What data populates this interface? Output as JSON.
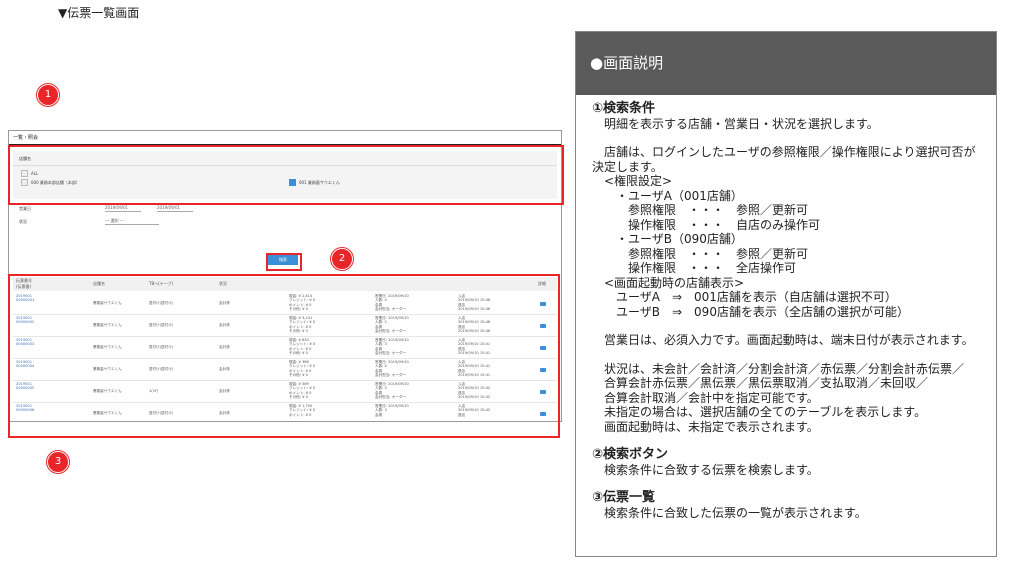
{
  "page_title": "▼伝票一覧画面",
  "mock": {
    "header": "一覧・照会",
    "panel_label": "店舗名",
    "checks": [
      {
        "label": "ALL",
        "checked": false
      },
      {
        "label": "000 業務本部店舗（本部）",
        "checked": false
      },
      {
        "label": "001 業務量サウエくん",
        "checked": true
      }
    ],
    "form": {
      "date_label": "営業日",
      "date_from": "2019/09/01",
      "date_to": "2019/09/01",
      "status_label": "状況",
      "status_value": "--- 選択 ---"
    },
    "search_button": "検索",
    "columns": [
      "伝票番号\n(伝票番)",
      "店舗名",
      "TBへ(テーブ)",
      "状況",
      "",
      "",
      "",
      "詳細"
    ],
    "rows": [
      {
        "id": "2019001\n00000001",
        "store": "業務量サウエくん",
        "table": "居付け(居付け)",
        "status": "会計済",
        "amounts": "現金: ¥ 2,414\nクレジット: ¥ 0\nポイント: ¥ 0\nその他: ¥ 0",
        "info": "営業日: 2019/09/10\n人数: 4\n会員\n会計担当: オーダー",
        "times": "入店\n2019/09/10 15:46\n退店\n2019/09/10 15:46"
      },
      {
        "id": "2019001\n00000002",
        "store": "業務量サウエくん",
        "table": "居付け(居付け)",
        "status": "会計済",
        "amounts": "現金: ¥ 3,141\nクレジット: ¥ 0\nポイント: ¥ 0\nその他: ¥ 0",
        "info": "営業日: 2019/09/10\n人数: 2\n会員\n会計担当: オーダー",
        "times": "入店\n2019/09/10 15:46\n退店\n2019/09/10 15:46"
      },
      {
        "id": "2019001\n00000003",
        "store": "業務量サウエくん",
        "table": "居付け(居付け)",
        "status": "会計済",
        "amounts": "現金: ¥ 633\nクレジット: ¥ 0\nポイント: ¥ 0\nその他: ¥ 0",
        "info": "営業日: 2019/09/10\n人数: 3\n会員\n会計担当: オーダー",
        "times": "入店\n2019/09/10 15:41\n退店\n2019/09/10 15:41"
      },
      {
        "id": "2019001\n00000004",
        "store": "業務量サウエくん",
        "table": "居付け(居付け)",
        "status": "会計済",
        "amounts": "現金: ¥ 386\nクレジット: ¥ 0\nポイント: ¥ 0\nその他: ¥ 0",
        "info": "営業日: 2019/09/10\n人数: 4\n会員\n会計担当: オーダー",
        "times": "入店\n2019/09/10 15:41\n退店\n2019/09/10 15:41"
      },
      {
        "id": "2019001\n00000005",
        "store": "業務量サウエくん",
        "table": "1(1F)",
        "status": "会計済",
        "amounts": "現金: ¥ 589\nクレジット: ¥ 0\nポイント: ¥ 0\nその他: ¥ 0",
        "info": "営業日: 2019/09/10\n人数: 3\n会員\n会計担当: オーダー",
        "times": "入店\n2019/09/10 15:42\n退店\n2019/09/10 15:42"
      },
      {
        "id": "2019001\n00000006",
        "store": "業務量サウエくん",
        "table": "居付け(居付け)",
        "status": "会計済",
        "amounts": "現金: ¥ 1,790\nクレジット: ¥ 0\nポイント: ¥ 0",
        "info": "営業日: 2019/09/10\n人数: 3\n会員",
        "times": "入店\n2019/09/10 15:42\n退店"
      }
    ]
  },
  "badges": [
    "1",
    "2",
    "3"
  ],
  "description": {
    "header": "●画面説明",
    "lines": [
      {
        "t": "①検索条件",
        "h": true
      },
      {
        "t": "　明細を表示する店舗・営業日・状況を選択します。"
      },
      {
        "t": "",
        "gap": true
      },
      {
        "t": "　店舗は、ログインしたユーザの参照権限／操作権限により選択可否が"
      },
      {
        "t": "決定します。"
      },
      {
        "t": "　<権限設定>"
      },
      {
        "t": "　　・ユーザA（001店舗）"
      },
      {
        "t": "　　　参照権限　・・・　参照／更新可"
      },
      {
        "t": "　　　操作権限　・・・　自店のみ操作可"
      },
      {
        "t": "　　・ユーザB（090店舗）"
      },
      {
        "t": "　　　参照権限　・・・　参照／更新可"
      },
      {
        "t": "　　　操作権限　・・・　全店操作可"
      },
      {
        "t": "　<画面起動時の店舗表示>"
      },
      {
        "t": "　　ユーザA　⇒　001店舗を表示（自店舗は選択不可）"
      },
      {
        "t": "　　ユーザB　⇒　090店舗を表示（全店舗の選択が可能）"
      },
      {
        "t": "",
        "gap": true
      },
      {
        "t": "　営業日は、必須入力です。画面起動時は、端末日付が表示されます。"
      },
      {
        "t": "",
        "gap": true
      },
      {
        "t": "　状況は、未会計／会計済／分割会計済／赤伝票／分割会計赤伝票／"
      },
      {
        "t": "　合算会計赤伝票／黒伝票／黒伝票取消／支払取消／未回収／"
      },
      {
        "t": "　合算会計取消／会計中を指定可能です。"
      },
      {
        "t": "　未指定の場合は、選択店舗の全てのテーブルを表示します。"
      },
      {
        "t": "　画面起動時は、未指定で表示されます。"
      },
      {
        "t": "",
        "gap": true
      },
      {
        "t": "②検索ボタン",
        "h": true
      },
      {
        "t": "　検索条件に合致する伝票を検索します。"
      },
      {
        "t": "",
        "gap": true
      },
      {
        "t": "③伝票一覧",
        "h": true
      },
      {
        "t": "　検索条件に合致した伝票の一覧が表示されます。"
      }
    ]
  }
}
